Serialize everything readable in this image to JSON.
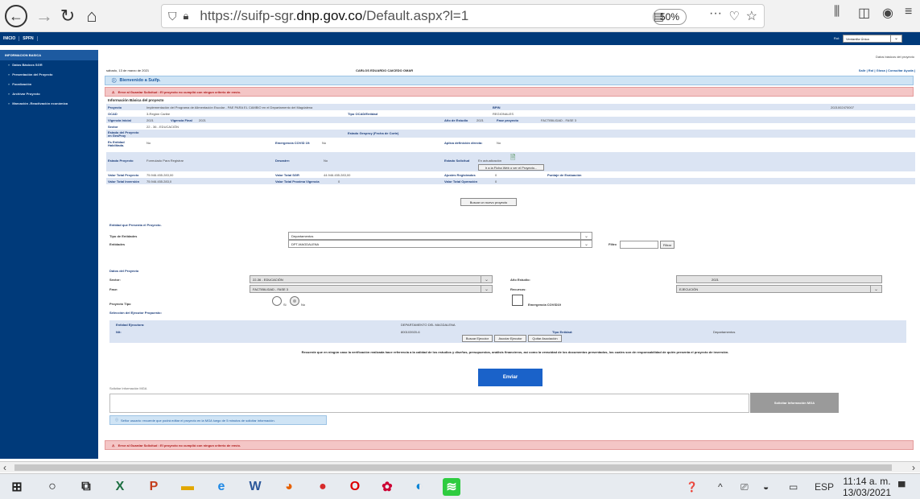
{
  "browser": {
    "url_prefix": "https://suifp-sgr.",
    "url_domain": "dnp.gov.co",
    "url_suffix": "/Default.aspx?l=1",
    "zoom": "50%",
    "more": "···"
  },
  "appbar": {
    "menu": [
      "INICIO",
      "SPFN"
    ],
    "rol_label": "Rol:",
    "rol_value": "Ventanilla Única"
  },
  "sidebar": {
    "header": "INFORMACION BASICA",
    "items": [
      "Datos Básicos SGR",
      "Presentación del Proyecto",
      "Focalización",
      "Archivar Proyecto",
      "Marcación -Reactivación económica"
    ]
  },
  "main": {
    "breadcrumb": "Datos básicos del proyecto",
    "date": "sábado, 13 de marzo de 2021",
    "user": "CARLOS EDUARDO CAICEDO OMAR",
    "top_links": "Salir | Rol | Glosa | Consultar Ayuda |",
    "welcome": "Bienvenido a Suifp.",
    "error_top": "Error al Guardar Solicitud : El proyecto no cumplió con ningun criterio de envío.",
    "error_bottom": "Error al Guardar Solicitud : El proyecto no cumplió con ningun criterio de envío.",
    "info_title": "Información Básica del proyecto",
    "rows": [
      {
        "l1": "Proyecto",
        "v1": "Implementación del Programa de Alimentación Escolar - PAE PARA EL CAMBIO en el Departamento del Magdalena",
        "l2": "BPIN",
        "v2": "2021002470007"
      },
      {
        "l1": "OCAD",
        "v1": "3-Región Caribe",
        "l2": "Tipo OCAD/Entidad",
        "v2": "REGIONALES"
      },
      {
        "l1": "Vigencia Inicial",
        "v1": "2021",
        "l1b": "Vigencia Final",
        "v1b": "2021",
        "l2": "Año de Estudio",
        "v2": "2021",
        "l3": "Fase proyecto",
        "v3": "FACTIBILIDAD - FASE 3"
      },
      {
        "l1": "Sector",
        "v1": "22 - 36 - EDUCACIÓN"
      },
      {
        "l1": "Estado del Proyecto en GesProy",
        "v1": "",
        "l2": "Estado Gesproy (Fecha de Corte)",
        "v2": ""
      },
      {
        "l1": "Es Entidad Habilitada.",
        "v1": "No",
        "l2": "Emergencia COVID 19:",
        "v2": "No",
        "l3": "Aplica definición directa:",
        "v3": "No"
      },
      {
        "l1": "Estado Proyecto",
        "v1": "Formulado Para Registrar",
        "l2": "Desastre:",
        "v2": "No",
        "l3": "Estado Solicitud",
        "v3": "En actualización"
      },
      {
        "l1": "Valor Total Proyecto",
        "v1": "75.946.455.283,00",
        "l2": "Valor Total SGR",
        "v2": "44.946.455.283,00",
        "l3": "Ajustes Registrados",
        "v3": "0",
        "l4": "Puntaje de Evaluación"
      },
      {
        "l1": "Valor Total Inversión",
        "v1": "75.946.455.283,0",
        "l2": "Valor Total Proxima Vigencia",
        "v2": "0",
        "l3": "Valor Total Operación",
        "v3": "0"
      }
    ],
    "btn_ficha": "Ir a la Ficha Web o ver el Proyecto...",
    "btn_buscar_proyecto": "Buscar un nuevo proyecto",
    "entidad_title": "Entidad que Presenta el Proyecto.",
    "tipo_entidades_label": "Tipo de Entidades",
    "tipo_entidades_value": "Departamentos",
    "entidades_label": "Entidades",
    "entidades_value": "DPT-MAGDALENA",
    "filtro_label": "Filtro",
    "filtro_btn": "Filtrar",
    "datos_title": "Datos del Proyecto",
    "sector_label": "Sector:",
    "sector_value": "22-36 - EDUCACIÓN",
    "anio_label": "Año Estudio:",
    "anio_value": "2021",
    "fase_label": "Fase:",
    "fase_value": "FACTIBILIDAD - FASE 3",
    "recursos_label": "Recursos:",
    "recursos_value": "EJECUCIÓN",
    "tipo_label": "Proyecto Tipo",
    "radio_si": "Si",
    "radio_no": "No",
    "covid_label": "Emergencia COVID19",
    "ejecutor_title": "Selección del Ejecutor Propuesto:",
    "ejecutor_label": "Entidad Ejecutora:",
    "ejecutor_value": "DEPARTAMENTO DEL MAGDALENA",
    "nit_label": "Nit:",
    "nit_value": "800103920-6",
    "tipo_entidad_label": "Tipo Entidad:",
    "tipo_entidad_value": "Departamentos",
    "btn_buscar_ejecutor": "Buscar Ejecutor",
    "btn_asociar_ejecutor": "Asociar Ejecutor",
    "btn_quitar": "Quitar Asociación",
    "recuerde": "Recuerde que en ningún caso la verificación realizada hace referencia a la calidad de los estudios y diseños, presupuestos, análisis financieros, así como la veracidad de los documentos presentados, los cuales son de responsabilidad de quién presenta el proyecto de inversión.",
    "enviar": "Enviar",
    "mga_label": "Solicitar Información MGA",
    "mga_btn": "Solicitar Información MGA",
    "note": "Señor usuario: recuerde que podrá editar el proyecto en la MGA luego de 5 minutos de solicitar información."
  },
  "taskbar": {
    "lang": "ESP",
    "time": "11:14 a. m.",
    "date": "13/03/2021"
  }
}
